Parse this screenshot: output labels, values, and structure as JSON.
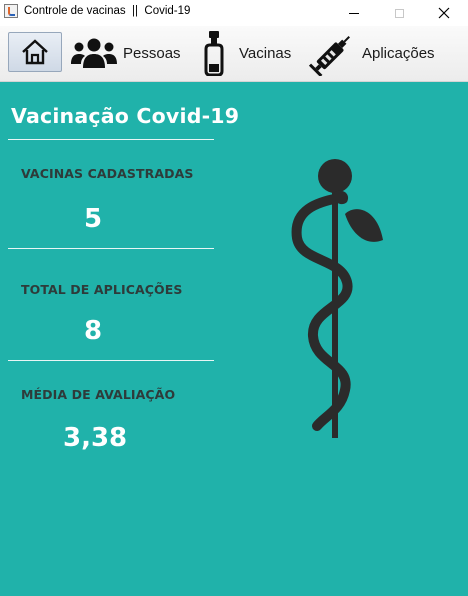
{
  "window": {
    "title": "Controle de vacinas  ||  Covid-19",
    "minimize_icon": "minimize-icon",
    "maximize_icon": "maximize-icon",
    "close_icon": "close-icon"
  },
  "toolbar": {
    "home_icon": "home-icon",
    "items": [
      {
        "label": "Pessoas",
        "icon": "people-icon"
      },
      {
        "label": "Vacinas",
        "icon": "vial-icon"
      },
      {
        "label": "Aplicações",
        "icon": "syringe-icon"
      }
    ]
  },
  "dashboard": {
    "title": "Vacinação Covid-19",
    "stats": [
      {
        "label": "VACINAS CADASTRADAS",
        "value": "5"
      },
      {
        "label": "TOTAL DE APLICAÇÕES",
        "value": "8"
      },
      {
        "label": "MÉDIA DE AVALIAÇÃO",
        "value": "3,38"
      }
    ],
    "emblem_icon": "caduceus-icon"
  },
  "colors": {
    "background": "#20b2aa",
    "text_light": "#ffffff",
    "text_dark": "#2e3b3a",
    "emblem": "#2b2b2b"
  }
}
